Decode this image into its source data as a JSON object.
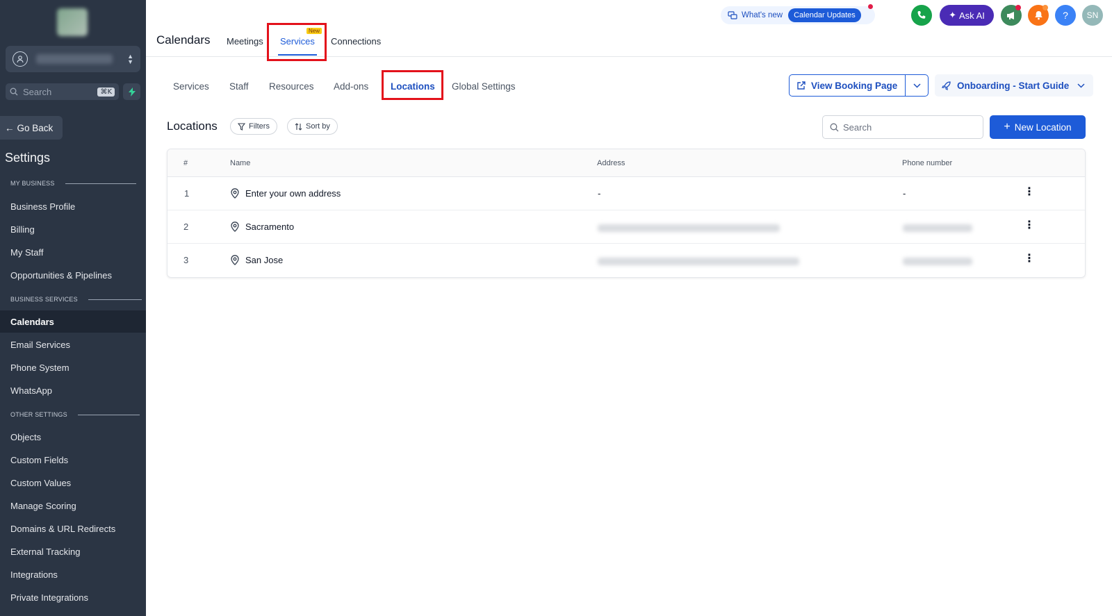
{
  "sidebar": {
    "search_placeholder": "Search",
    "search_shortcut": "⌘K",
    "go_back": "Go Back",
    "title": "Settings",
    "sections": [
      {
        "label": "MY BUSINESS",
        "items": [
          "Business Profile",
          "Billing",
          "My Staff",
          "Opportunities & Pipelines"
        ]
      },
      {
        "label": "BUSINESS SERVICES",
        "items": [
          "Calendars",
          "Email Services",
          "Phone System",
          "WhatsApp"
        ]
      },
      {
        "label": "OTHER SETTINGS",
        "items": [
          "Objects",
          "Custom Fields",
          "Custom Values",
          "Manage Scoring",
          "Domains & URL Redirects",
          "External Tracking",
          "Integrations",
          "Private Integrations"
        ]
      }
    ],
    "active_item": "Calendars"
  },
  "header": {
    "title": "Calendars",
    "tabs": [
      {
        "label": "Meetings"
      },
      {
        "label": "Services",
        "badge": "New"
      },
      {
        "label": "Connections"
      }
    ],
    "active_tab": "Services",
    "whats_new": "What's new",
    "calendar_updates": "Calendar Updates",
    "ask_ai": "Ask AI",
    "help": "?",
    "avatar_initials": "SN"
  },
  "subtabs": {
    "items": [
      "Services",
      "Staff",
      "Resources",
      "Add-ons",
      "Locations",
      "Global Settings"
    ],
    "active": "Locations",
    "view_booking": "View Booking Page",
    "onboarding": "Onboarding - Start Guide"
  },
  "locations": {
    "title": "Locations",
    "filters": "Filters",
    "sort_by": "Sort by",
    "search_placeholder": "Search",
    "new_location": "New Location",
    "columns": [
      "#",
      "Name",
      "Address",
      "Phone number"
    ],
    "rows": [
      {
        "num": "1",
        "name": "Enter your own address",
        "address": "-",
        "phone": "-"
      },
      {
        "num": "2",
        "name": "Sacramento",
        "address": "",
        "phone": ""
      },
      {
        "num": "3",
        "name": "San Jose",
        "address": "",
        "phone": ""
      }
    ]
  },
  "colors": {
    "sidebar_bg": "#2b3544",
    "accent": "#1d5bd8",
    "highlight_box": "#e3121b",
    "ask_ai": "#4a2bb5",
    "phone_btn": "#16a34a",
    "bell_btn": "#f97316",
    "help_btn": "#3b82f6"
  }
}
